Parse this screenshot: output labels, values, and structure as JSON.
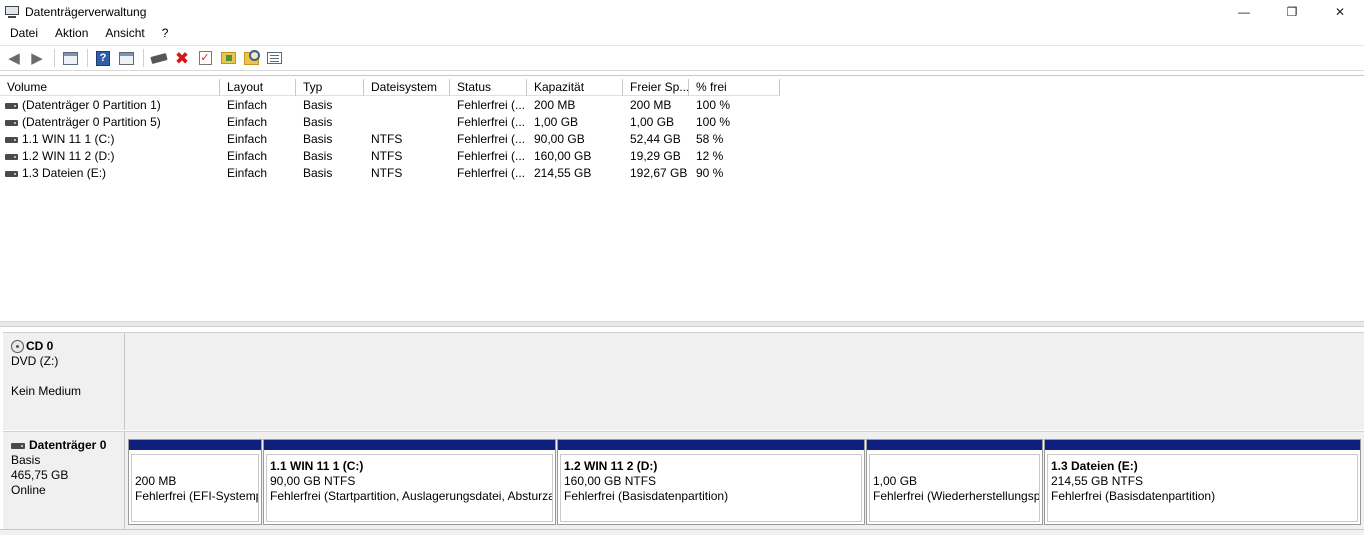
{
  "window": {
    "title": "Datenträgerverwaltung",
    "minimize": "—",
    "maximize": "❐",
    "close": "✕"
  },
  "menu": [
    "Datei",
    "Aktion",
    "Ansicht",
    "?"
  ],
  "toolbar_icons": [
    "back-arrow-icon",
    "forward-arrow-icon",
    "console-tree-icon",
    "help-icon",
    "action-pane-icon",
    "connect-disk-icon",
    "delete-icon",
    "check-icon",
    "folder-up-icon",
    "folder-search-icon",
    "properties-icon"
  ],
  "list": {
    "columns": [
      "Volume",
      "Layout",
      "Typ",
      "Dateisystem",
      "Status",
      "Kapazität",
      "Freier Sp...",
      "% frei"
    ],
    "rows": [
      [
        "(Datenträger 0 Partition 1)",
        "Einfach",
        "Basis",
        "",
        "Fehlerfrei (...",
        "200 MB",
        "200 MB",
        "100 %"
      ],
      [
        "(Datenträger 0 Partition 5)",
        "Einfach",
        "Basis",
        "",
        "Fehlerfrei (...",
        "1,00 GB",
        "1,00 GB",
        "100 %"
      ],
      [
        "1.1 WIN 11 1 (C:)",
        "Einfach",
        "Basis",
        "NTFS",
        "Fehlerfrei (...",
        "90,00 GB",
        "52,44 GB",
        "58 %"
      ],
      [
        "1.2 WIN 11 2 (D:)",
        "Einfach",
        "Basis",
        "NTFS",
        "Fehlerfrei (...",
        "160,00 GB",
        "19,29 GB",
        "12 %"
      ],
      [
        "1.3 Dateien (E:)",
        "Einfach",
        "Basis",
        "NTFS",
        "Fehlerfrei (...",
        "214,55 GB",
        "192,67 GB",
        "90 %"
      ]
    ]
  },
  "cd": {
    "name": "CD 0",
    "type": "DVD (Z:)",
    "status": "Kein Medium"
  },
  "disk0": {
    "name": "Datenträger 0",
    "type": "Basis",
    "size": "465,75 GB",
    "state": "Online",
    "partitions": [
      {
        "name": "",
        "size": "200 MB",
        "status": "Fehlerfrei (EFI-Systempartition)"
      },
      {
        "name": "1.1 WIN 11 1  (C:)",
        "size": "90,00 GB NTFS",
        "status": "Fehlerfrei (Startpartition, Auslagerungsdatei, Absturzabbild, Primäre Partition)"
      },
      {
        "name": "1.2 WIN 11 2  (D:)",
        "size": "160,00 GB NTFS",
        "status": "Fehlerfrei (Basisdatenpartition)"
      },
      {
        "name": "",
        "size": "1,00 GB",
        "status": "Fehlerfrei (Wiederherstellungspartition)"
      },
      {
        "name": "1.3 Dateien  (E:)",
        "size": "214,55 GB NTFS",
        "status": "Fehlerfrei (Basisdatenpartition)"
      }
    ]
  },
  "colors": {
    "partition_header": "#0e1f7d",
    "panel_bg": "#f0f0f0"
  }
}
